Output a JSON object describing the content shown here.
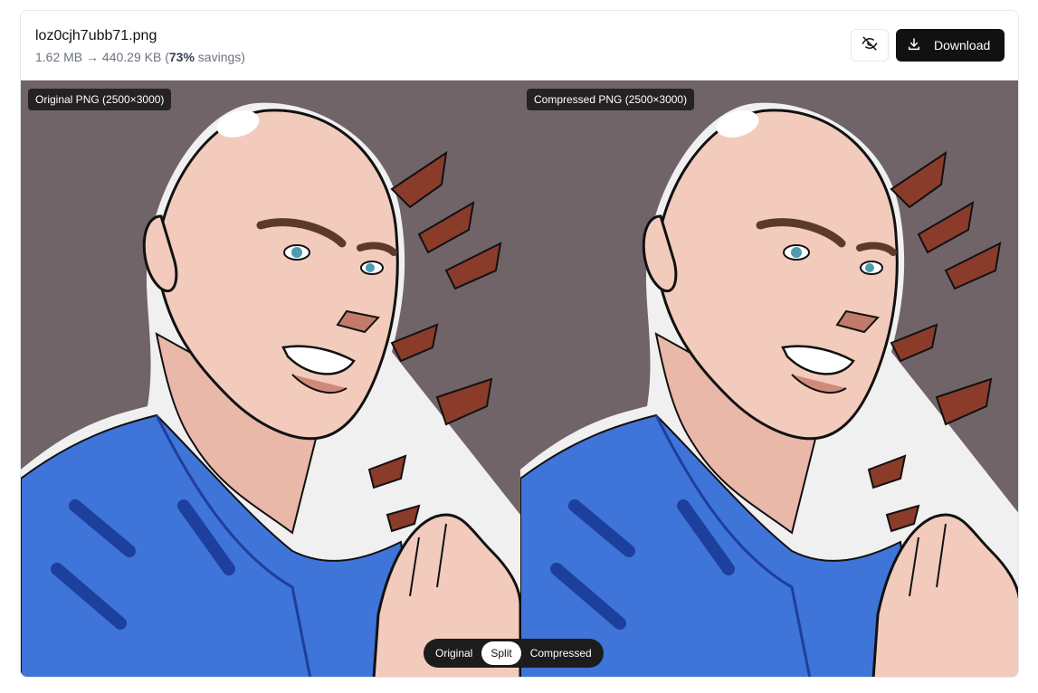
{
  "file": {
    "name": "loz0cjh7ubb71.png",
    "original_size": "1.62 MB",
    "arrow": "→",
    "compressed_size": "440.29 KB",
    "savings_percent": "73%",
    "savings_word": "savings"
  },
  "toolbar": {
    "hide_icon": "eye-off-icon",
    "download_icon": "download-icon",
    "download_label": "Download"
  },
  "panes": {
    "original_label": "Original PNG (2500×3000)",
    "compressed_label": "Compressed PNG (2500×3000)"
  },
  "view_modes": {
    "options": [
      "Original",
      "Split",
      "Compressed"
    ],
    "selected": "Split"
  },
  "colors": {
    "accent": "#111111",
    "background_art": "#716469",
    "skin": "#f2cbbd",
    "shirt": "#3f74d8",
    "menacing_glyphs": "#8a3b2a"
  }
}
